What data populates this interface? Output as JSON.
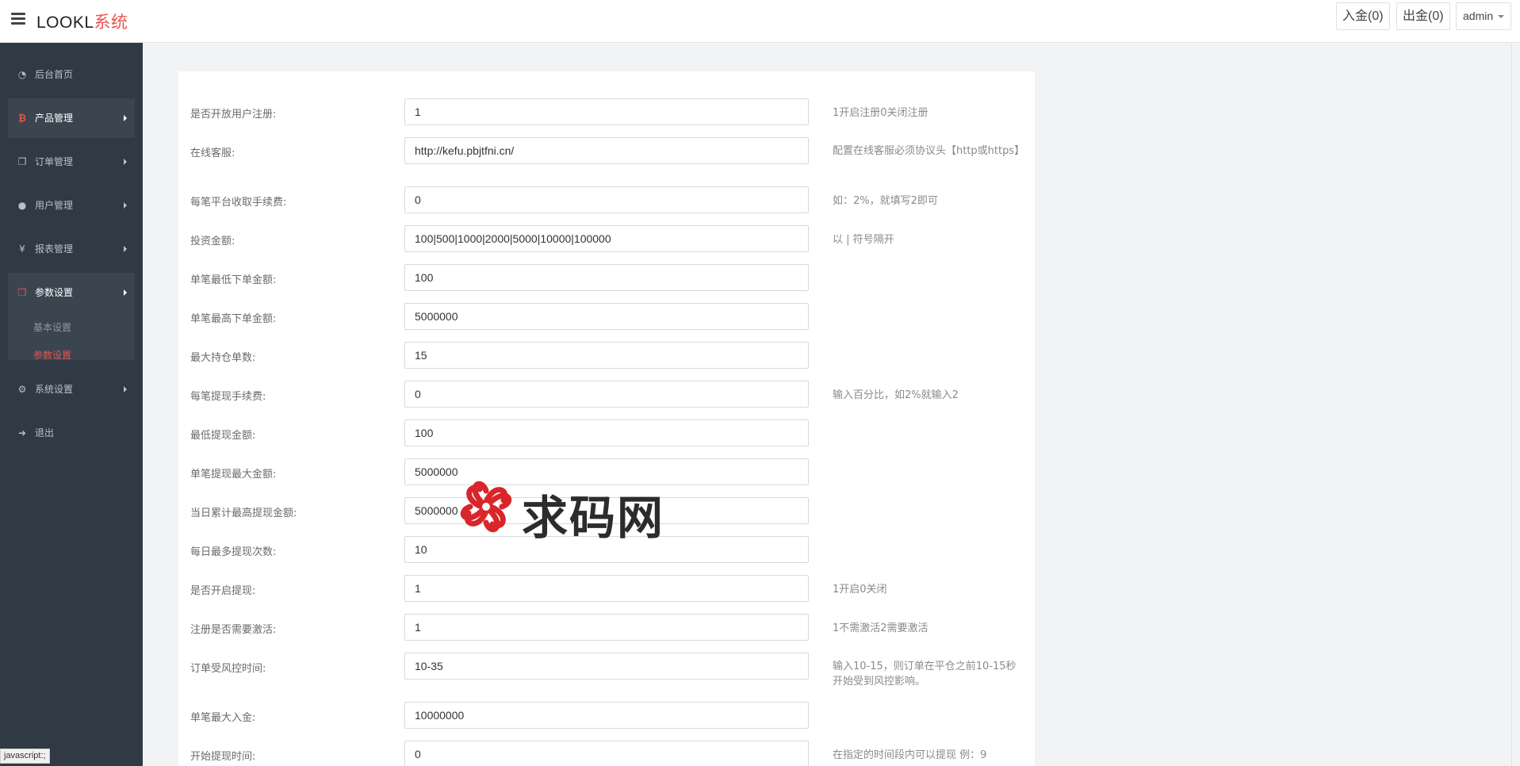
{
  "brand": {
    "main": "LOOKL",
    "accent": "系统"
  },
  "top_buttons": {
    "deposit": "入金(0)",
    "withdraw": "出金(0)",
    "admin": "admin"
  },
  "sidebar": {
    "items": [
      {
        "label": "后台首页",
        "icon": "dashboard-icon"
      },
      {
        "label": "产品管理",
        "icon": "bitcoin-icon"
      },
      {
        "label": "订单管理",
        "icon": "copy-icon"
      },
      {
        "label": "用户管理",
        "icon": "user-icon"
      },
      {
        "label": "报表管理",
        "icon": "yen-icon"
      },
      {
        "label": "参数设置",
        "icon": "files-icon"
      },
      {
        "label": "系统设置",
        "icon": "gears-icon"
      },
      {
        "label": "退出",
        "icon": "sign-out-icon"
      }
    ],
    "submenu": [
      {
        "label": "基本设置"
      },
      {
        "label": "参数设置"
      }
    ]
  },
  "status_bar": "javascript:;",
  "form": {
    "rows": [
      {
        "label": "是否开放用户注册:",
        "value": "1",
        "hint": "1开启注册0关闭注册"
      },
      {
        "label": "在线客服:",
        "value": "http://kefu.pbjtfni.cn/",
        "hint": "配置在线客服必须协议头【http或https】"
      },
      {
        "label": "每笔平台收取手续费:",
        "value": "0",
        "hint": "如：2%，就填写2即可"
      },
      {
        "label": "投资金额:",
        "value": "100|500|1000|2000|5000|10000|100000",
        "hint": "以 | 符号隔开"
      },
      {
        "label": "单笔最低下单金额:",
        "value": "100",
        "hint": ""
      },
      {
        "label": "单笔最高下单金额:",
        "value": "5000000",
        "hint": ""
      },
      {
        "label": "最大持仓单数:",
        "value": "15",
        "hint": ""
      },
      {
        "label": "每笔提现手续费:",
        "value": "0",
        "hint": "输入百分比，如2%就输入2"
      },
      {
        "label": "最低提现金额:",
        "value": "100",
        "hint": ""
      },
      {
        "label": "单笔提现最大金额:",
        "value": "5000000",
        "hint": ""
      },
      {
        "label": "当日累计最高提现金额:",
        "value": "5000000",
        "hint": ""
      },
      {
        "label": "每日最多提现次数:",
        "value": "10",
        "hint": ""
      },
      {
        "label": "是否开启提现:",
        "value": "1",
        "hint": "1开启0关闭"
      },
      {
        "label": "注册是否需要激活:",
        "value": "1",
        "hint": "1不需激活2需要激活"
      },
      {
        "label": "订单受风控时间:",
        "value": "10-35",
        "hint": "输入10-15，则订单在平仓之前10-15秒开始受到风控影响。"
      },
      {
        "label": "单笔最大入金:",
        "value": "10000000",
        "hint": ""
      },
      {
        "label": "开始提现时间:",
        "value": "0",
        "hint": "在指定的时间段内可以提现 例：9"
      }
    ]
  },
  "watermark": {
    "text": "求码网"
  },
  "colors": {
    "accent": "#e8544d",
    "sidebar_bg": "#2f3a45",
    "sidebar_expanded_bg": "#3a4550",
    "page_bg": "#f2f3f5"
  }
}
